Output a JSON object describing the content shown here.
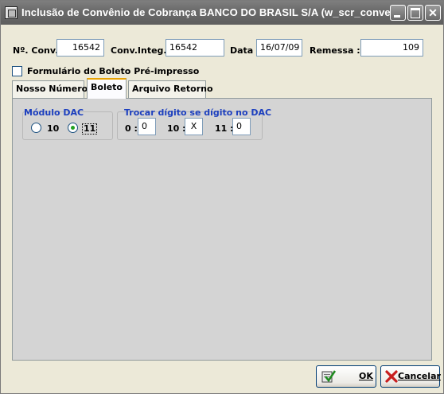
{
  "window": {
    "title": "Inclusão de Convênio de Cobrança BANCO DO BRASIL S/A (w_scr_conve..."
  },
  "header": {
    "conv_label": "Nº. Conv.:",
    "conv_value": "16542",
    "conv_integ_label": "Conv.Integ.:",
    "conv_integ_value": "16542",
    "data_label": "Data :",
    "data_value": "16/07/09",
    "remessa_label": "Remessa :",
    "remessa_value": "109"
  },
  "formulario": {
    "label": "Formulário do Boleto Pré-impresso",
    "checked": false
  },
  "tabs": [
    {
      "label": "Nosso Número",
      "active": false
    },
    {
      "label": "Boleto",
      "active": true
    },
    {
      "label": "Arquivo Retorno",
      "active": false
    }
  ],
  "modulo_dac": {
    "title": "Módulo DAC",
    "options": [
      {
        "label": "10",
        "selected": false
      },
      {
        "label": "11",
        "selected": true
      }
    ]
  },
  "trocar": {
    "title": "Trocar dígito se dígito no DAC",
    "fields": [
      {
        "label": "0 :",
        "value": "0"
      },
      {
        "label": "10 :",
        "value": "X"
      },
      {
        "label": "11 :",
        "value": "0"
      }
    ]
  },
  "buttons": {
    "ok_label": "OK",
    "cancel_label": "Cancelar"
  },
  "colors": {
    "group_title": "#1c3fbf",
    "titlebar": "#6b6b6b",
    "panel": "#d4d4d4"
  },
  "icons": {
    "window": "app-window-icon",
    "ok": "checkmark-document-icon",
    "cancel": "red-x-icon"
  }
}
